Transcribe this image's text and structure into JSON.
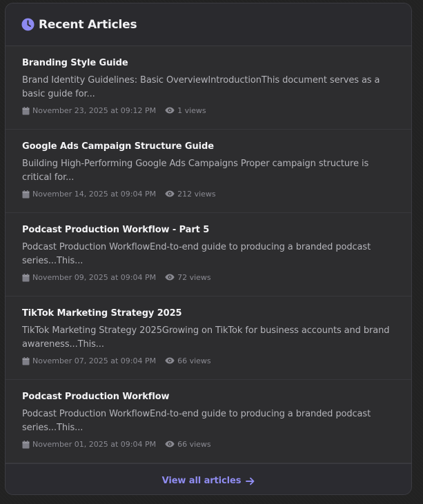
{
  "header": {
    "title": "Recent Articles",
    "icon": "clock-icon",
    "accent": "#8d8af2"
  },
  "articles": [
    {
      "title": "Branding Style Guide",
      "excerpt": "Brand Identity Guidelines: Basic OverviewIntroductionThis document serves as a basic guide for...",
      "date": "November 23, 2025 at 09:12 PM",
      "views": "1 views"
    },
    {
      "title": "Google Ads Campaign Structure Guide",
      "excerpt": "Building High-Performing Google Ads Campaigns Proper campaign structure is critical for...",
      "date": "November 14, 2025 at 09:04 PM",
      "views": "212 views"
    },
    {
      "title": "Podcast Production Workflow - Part 5",
      "excerpt": "Podcast Production WorkflowEnd-to-end guide to producing a branded podcast series...This...",
      "date": "November 09, 2025 at 09:04 PM",
      "views": "72 views"
    },
    {
      "title": "TikTok Marketing Strategy 2025",
      "excerpt": "TikTok Marketing Strategy 2025Growing on TikTok for business accounts and brand awareness...This...",
      "date": "November 07, 2025 at 09:04 PM",
      "views": "66 views"
    },
    {
      "title": "Podcast Production Workflow",
      "excerpt": "Podcast Production WorkflowEnd-to-end guide to producing a branded podcast series...This...",
      "date": "November 01, 2025 at 09:04 PM",
      "views": "66 views"
    }
  ],
  "footer": {
    "link_label": "View all articles",
    "icon": "arrow-right-icon"
  }
}
